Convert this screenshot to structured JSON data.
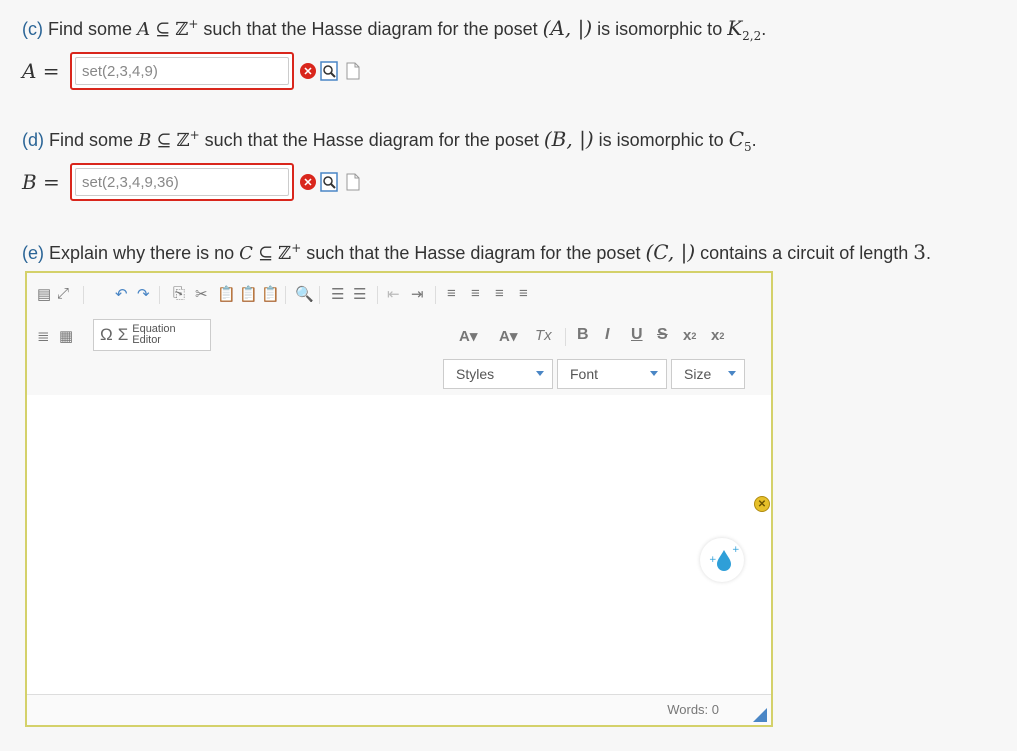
{
  "part_c": {
    "label": "(c)",
    "text_before": "Find some",
    "set_var": "A",
    "subset": "⊆",
    "universe": "ℤ",
    "universe_sup": "+",
    "text_mid": "such that the Hasse diagram for the poset",
    "poset": "(A, |)",
    "text_after": "is isomorphic to",
    "target": "K",
    "target_sub": "2,2",
    "end": ".",
    "answer_var": "A =",
    "answer_value": "set(2,3,4,9)"
  },
  "part_d": {
    "label": "(d)",
    "text_before": "Find some",
    "set_var": "B",
    "subset": "⊆",
    "universe": "ℤ",
    "universe_sup": "+",
    "text_mid": "such that the Hasse diagram for the poset",
    "poset": "(B, |)",
    "text_after": "is isomorphic to",
    "target": "C",
    "target_sub": "5",
    "end": ".",
    "answer_var": "B =",
    "answer_value": "set(2,3,4,9,36)"
  },
  "part_e": {
    "label": "(e)",
    "text_before": "Explain why there is no",
    "set_var": "C",
    "subset": "⊆",
    "universe": "ℤ",
    "universe_sup": "+",
    "text_mid": "such that the Hasse diagram for the poset",
    "poset": "(C, |)",
    "text_after": "contains a circuit of length",
    "length": "3",
    "end": "."
  },
  "status": {
    "incorrect_icon": "x-circle-icon",
    "warning_icon": "warning-icon",
    "incorrect_color": "#d9261c",
    "warning_color": "#e6c02a"
  },
  "editor": {
    "equation_editor_line1": "Equation",
    "equation_editor_line2": "Editor",
    "styles_label": "Styles",
    "font_label": "Font",
    "size_label": "Size",
    "bold": "B",
    "italic": "I",
    "underline": "U",
    "strike": "S",
    "omega": "Ω",
    "sigma": "Σ",
    "words_label": "Words: 0",
    "border_color": "#d4d16a",
    "accent_color": "#4a86c5"
  }
}
